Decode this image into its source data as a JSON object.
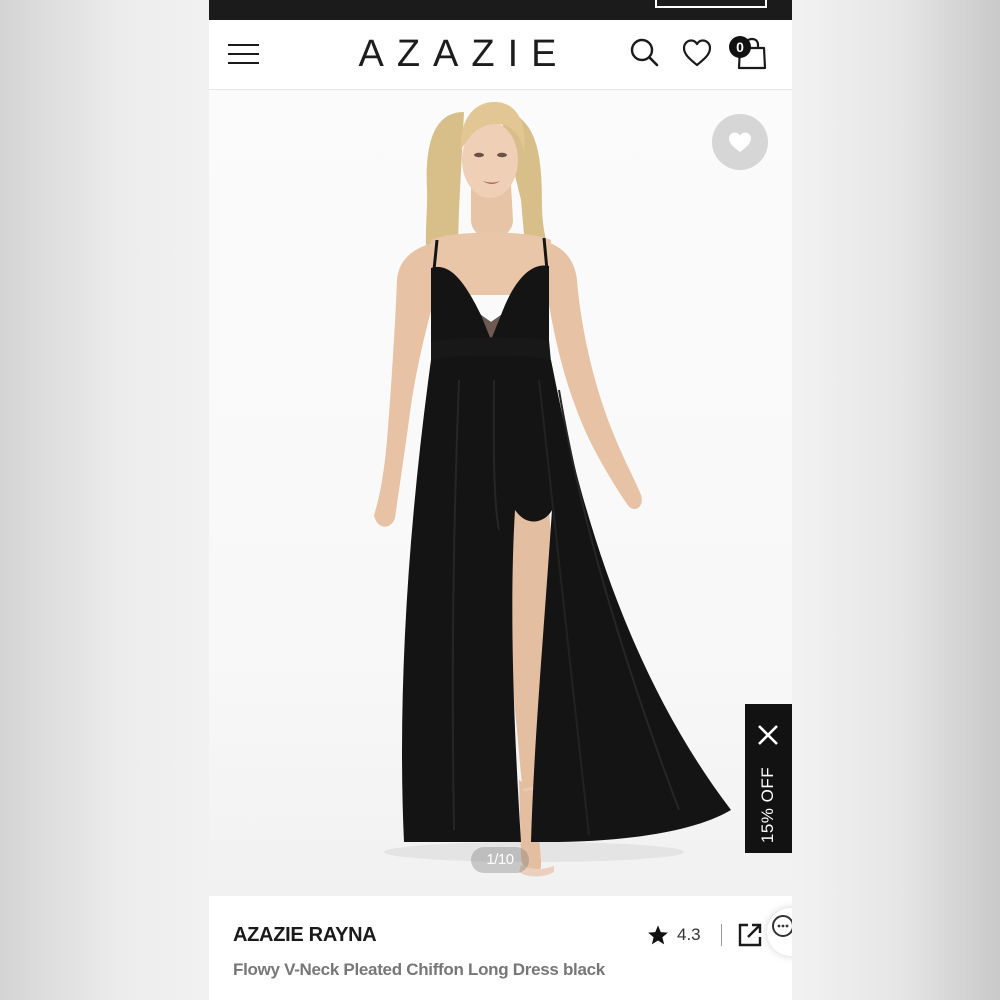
{
  "header": {
    "brand": "AZAZIE",
    "bag_count": "0",
    "icons": [
      "menu-icon",
      "search-icon",
      "heart-icon",
      "shopping-bag-icon"
    ]
  },
  "gallery": {
    "page_indicator": "1/10",
    "promo_label": "15% OFF",
    "icons": [
      "heart-icon",
      "close-icon"
    ]
  },
  "product": {
    "name": "AZAZIE RAYNA",
    "description": "Flowy V-Neck Pleated Chiffon Long Dress black",
    "rating": "4.3",
    "icons": [
      "star-icon",
      "share-icon",
      "chat-icon"
    ]
  },
  "colors": {
    "dress": "#141414",
    "accent": "#121212",
    "muted_text": "#777777"
  }
}
